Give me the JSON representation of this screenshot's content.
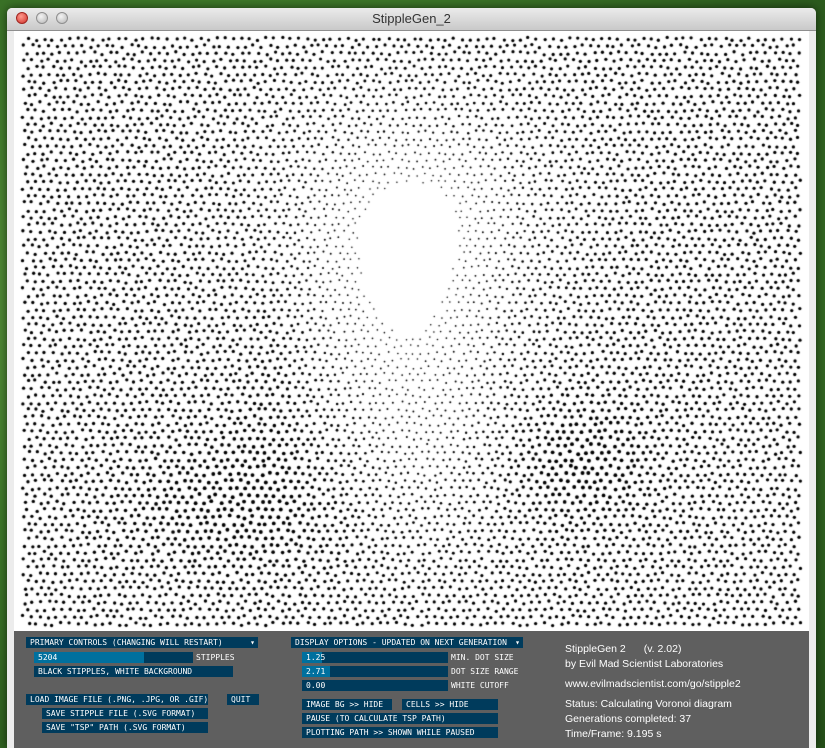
{
  "window": {
    "title": "StippleGen_2"
  },
  "primary": {
    "dropdown_label": "PRIMARY CONTROLS (CHANGING WILL RESTART)",
    "stipples": {
      "value": "5204",
      "label": "STIPPLES",
      "fill": 0.69
    },
    "mode_label": "BLACK STIPPLES, WHITE BACKGROUND",
    "load_label": "LOAD IMAGE FILE (.PNG, .JPG, OR .GIF)",
    "quit_label": "QUIT",
    "save_stipple_label": "SAVE STIPPLE FILE (.SVG FORMAT)",
    "save_tsp_label": "SAVE \"TSP\" PATH (.SVG FORMAT)"
  },
  "display": {
    "dropdown_label": "DISPLAY OPTIONS - UPDATED ON NEXT GENERATION",
    "min_dot_size": {
      "value": "1.25",
      "label": "MIN. DOT SIZE",
      "fill": 0.14
    },
    "dot_size_range": {
      "value": "2.71",
      "label": "DOT SIZE RANGE",
      "fill": 0.19
    },
    "white_cutoff": {
      "value": "0.00",
      "label": "WHITE CUTOFF",
      "fill": 0.0
    },
    "image_bg_label": "IMAGE BG >> HIDE",
    "cells_label": "CELLS >> HIDE",
    "pause_label": "PAUSE (TO CALCULATE TSP PATH)",
    "plotting_label": "PLOTTING PATH >> SHOWN WHILE PAUSED"
  },
  "info": {
    "app_name": "StippleGen 2",
    "version": "(v. 2.02)",
    "author": "by Evil Mad Scientist Laboratories",
    "url": "www.evilmadscientist.com/go/stipple2",
    "status": "Status: Calculating Voronoi diagram",
    "generations": "Generations completed: 37",
    "time_frame": "Time/Frame: 9.195 s"
  },
  "colors": {
    "control_bg": "#003b5c",
    "slider_fill": "#00709e",
    "panel_bg": "#5f5f5f"
  },
  "icons": [
    "close-button-icon",
    "minimize-button-icon",
    "zoom-button-icon",
    "dropdown-arrow-icon"
  ]
}
